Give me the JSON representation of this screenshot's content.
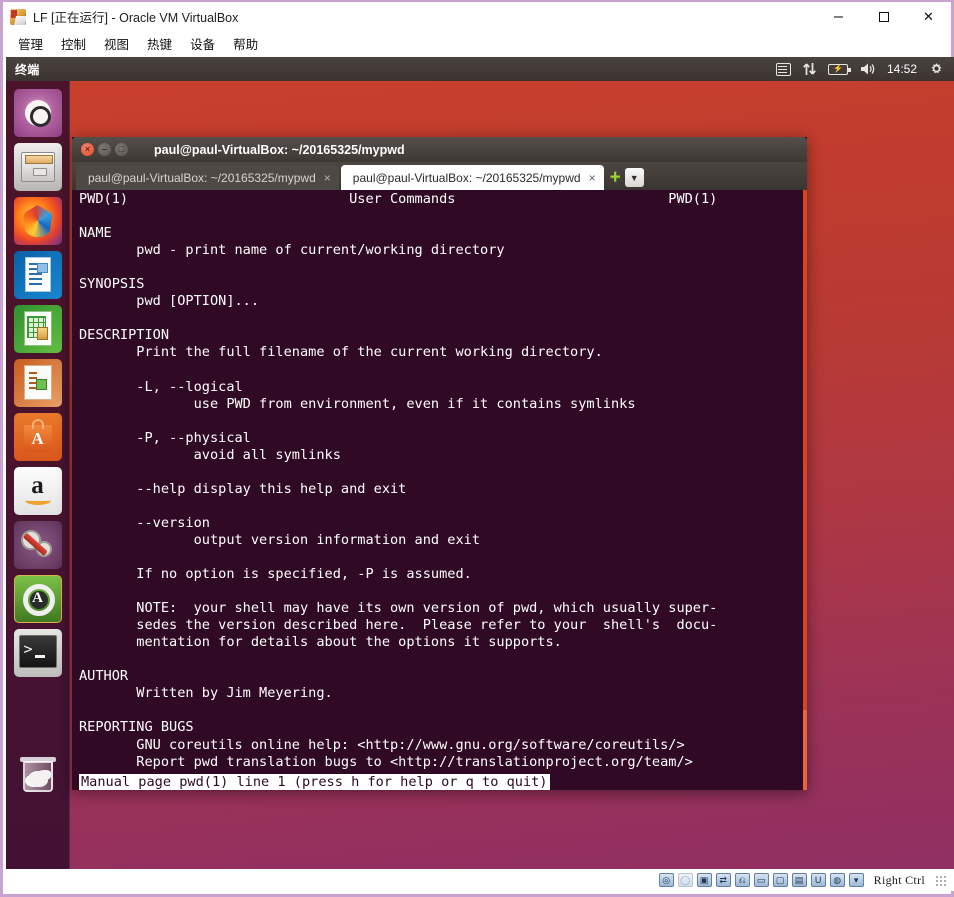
{
  "vbox": {
    "title": "LF [正在运行] - Oracle VM VirtualBox",
    "app_icon": "virtualbox-icon",
    "window_buttons": {
      "minimize": "–",
      "maximize": "□",
      "close": "✕"
    },
    "menu": [
      {
        "label": "管理",
        "name": "menu-manage"
      },
      {
        "label": "控制",
        "name": "menu-machine"
      },
      {
        "label": "视图",
        "name": "menu-view"
      },
      {
        "label": "热键",
        "name": "menu-input"
      },
      {
        "label": "设备",
        "name": "menu-devices"
      },
      {
        "label": "帮助",
        "name": "menu-help"
      }
    ],
    "statusbar": {
      "host_key": "Right Ctrl",
      "icons": [
        "hard-disk-icon",
        "optical-disk-icon",
        "floppy-icon",
        "network-icon",
        "usb-icon",
        "shared-folder-icon",
        "display-icon",
        "recording-icon",
        "features-icon",
        "mouse-icon",
        "keyboard-icon"
      ]
    }
  },
  "ubuntu_panel": {
    "app_name": "终端",
    "clock": "14:52",
    "indicators": [
      "keyboard-icon",
      "network-icon",
      "battery-icon",
      "volume-icon",
      "clock",
      "gear-icon"
    ]
  },
  "launcher": {
    "items": [
      {
        "name": "launcher-item-dash-home",
        "icon": "ubuntu-dash-icon",
        "label": "Dash home"
      },
      {
        "name": "launcher-item-files",
        "icon": "files-icon",
        "label": "Files"
      },
      {
        "name": "launcher-item-firefox",
        "icon": "firefox-icon",
        "label": "Firefox Web Browser"
      },
      {
        "name": "launcher-item-writer",
        "icon": "libreoffice-writer-icon",
        "label": "LibreOffice Writer"
      },
      {
        "name": "launcher-item-calc",
        "icon": "libreoffice-calc-icon",
        "label": "LibreOffice Calc"
      },
      {
        "name": "launcher-item-impress",
        "icon": "libreoffice-impress-icon",
        "label": "LibreOffice Impress"
      },
      {
        "name": "launcher-item-software",
        "icon": "ubuntu-software-icon",
        "label": "Ubuntu Software"
      },
      {
        "name": "launcher-item-amazon",
        "icon": "amazon-icon",
        "label": "Amazon"
      },
      {
        "name": "launcher-item-settings",
        "icon": "system-settings-icon",
        "label": "System Settings"
      },
      {
        "name": "launcher-item-updater",
        "icon": "software-updater-icon",
        "label": "Software Updater"
      },
      {
        "name": "launcher-item-terminal",
        "icon": "terminal-icon",
        "label": "Terminal"
      },
      {
        "name": "launcher-item-trash",
        "icon": "trash-icon",
        "label": "Trash"
      }
    ]
  },
  "terminal": {
    "window_title": "paul@paul-VirtualBox: ~/20165325/mypwd",
    "titlebar_buttons": {
      "close": "×",
      "minimize": "–",
      "maximize": "□"
    },
    "tabs": [
      {
        "label": "paul@paul-VirtualBox: ~/20165325/mypwd",
        "close": "×",
        "active": false
      },
      {
        "label": "paul@paul-VirtualBox: ~/20165325/mypwd",
        "close": "×",
        "active": true
      }
    ],
    "new_tab_button": "+",
    "tab_menu_button": "▼",
    "content": "PWD(1)                           User Commands                          PWD(1)\n\nNAME\n       pwd - print name of current/working directory\n\nSYNOPSIS\n       pwd [OPTION]...\n\nDESCRIPTION\n       Print the full filename of the current working directory.\n\n       -L, --logical\n              use PWD from environment, even if it contains symlinks\n\n       -P, --physical\n              avoid all symlinks\n\n       --help display this help and exit\n\n       --version\n              output version information and exit\n\n       If no option is specified, -P is assumed.\n\n       NOTE:  your shell may have its own version of pwd, which usually super‐\n       sedes the version described here.  Please refer to your  shell's  docu‐\n       mentation for details about the options it supports.\n\nAUTHOR\n       Written by Jim Meyering.\n\nREPORTING BUGS\n       GNU coreutils online help: <http://www.gnu.org/software/coreutils/>\n       Report pwd translation bugs to <http://translationproject.org/team/>",
    "status_line": "Manual page pwd(1) line 1 (press h for help or q to quit)",
    "colors": {
      "background": "#300a24",
      "foreground": "#ffffff",
      "scrollbar": "#e8663d"
    }
  },
  "desktop": {
    "gradient_top": "#c9402d",
    "gradient_bottom": "#8f2f63"
  }
}
